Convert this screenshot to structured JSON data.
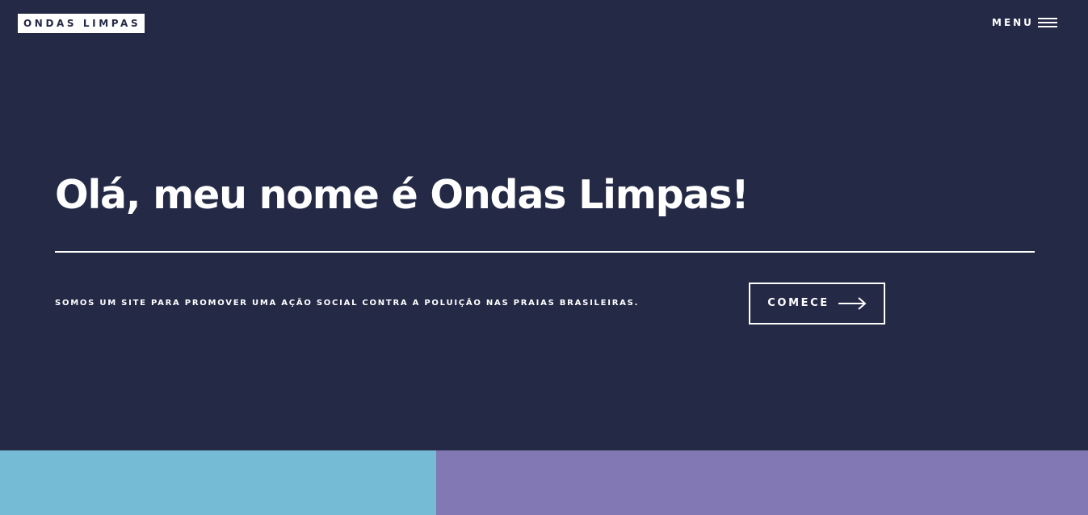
{
  "header": {
    "logo_text": "ONDAS LIMPAS",
    "menu_label": "MENU",
    "menu_icon": "hamburger-icon"
  },
  "hero": {
    "headline": "Olá, meu nome é Ondas Limpas!",
    "tagline": "SOMOS UM SITE PARA PROMOVER UMA AÇÃO SOCIAL CONTRA A POLUIÇÃO NAS PRAIAS BRASILEIRAS.",
    "cta_label": "COMECE",
    "cta_icon": "arrow-right-icon"
  },
  "colors": {
    "background": "#242946",
    "text": "#ffffff",
    "panel_left": "#75bbd5",
    "panel_right": "#8279b4"
  }
}
